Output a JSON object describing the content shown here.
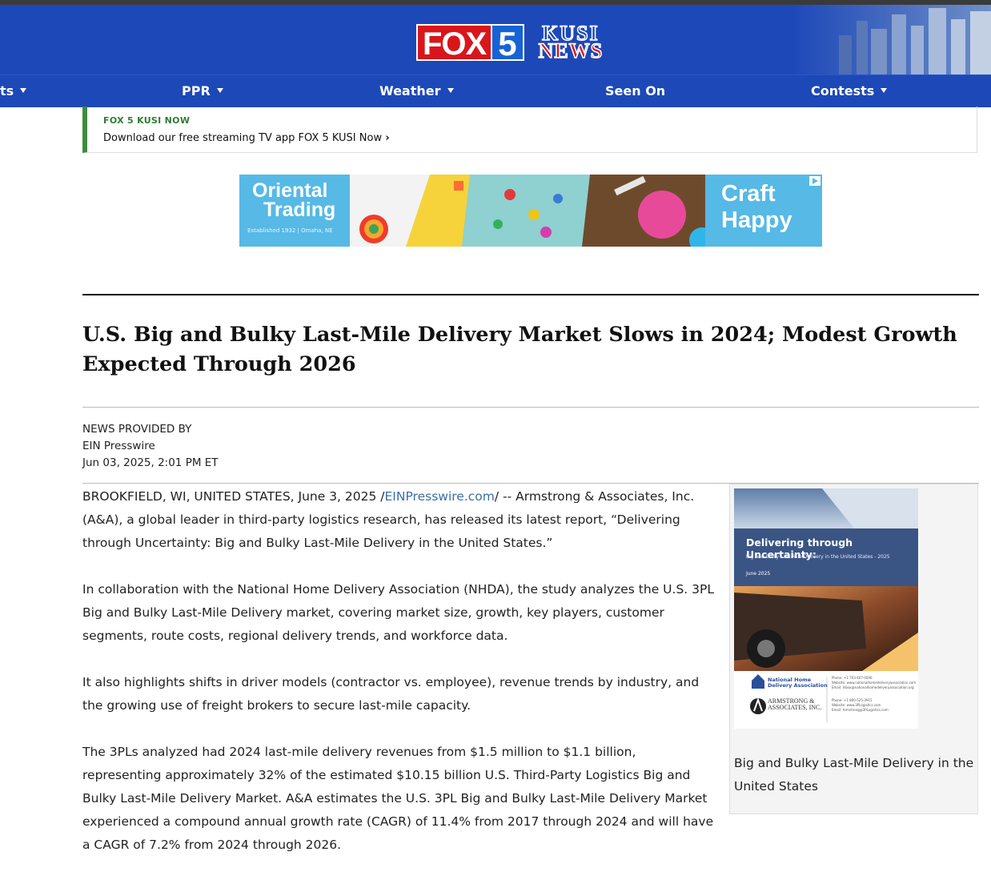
{
  "header": {
    "logo_fox": "FOX",
    "logo_fox_number": "5",
    "logo_kusi_top": "KUSI",
    "logo_kusi_bottom": "NEWS"
  },
  "nav": {
    "items": [
      {
        "label": "ts",
        "has_dropdown": true
      },
      {
        "label": "PPR",
        "has_dropdown": true
      },
      {
        "label": "Weather",
        "has_dropdown": true
      },
      {
        "label": "Seen On",
        "has_dropdown": false
      },
      {
        "label": "Contests",
        "has_dropdown": true
      }
    ]
  },
  "promo": {
    "kicker": "FOX 5 KUSI NOW",
    "text": "Download our free streaming TV app FOX 5 KUSI Now",
    "chevron": "›"
  },
  "ad": {
    "brand_line1": "Oriental",
    "brand_line2": "Trading",
    "established": "Established 1932 | Omaha, NE",
    "cta_line1": "Craft",
    "cta_line2": "Happy"
  },
  "article": {
    "title": "U.S. Big and Bulky Last-Mile Delivery Market Slows in 2024; Modest Growth Expected Through 2026",
    "provided_label": "NEWS PROVIDED BY",
    "provider": "EIN Presswire",
    "datetime": "Jun 03, 2025, 2:01 PM ET",
    "p1_before": "BROOKFIELD, WI, UNITED STATES, June 3, 2025 /",
    "p1_link": "EINPresswire.com",
    "p1_after": "/ -- Armstrong & Associates, Inc. (A&A), a global leader in third-party logistics research, has released its latest report, “Delivering through Uncertainty: Big and Bulky Last-Mile Delivery in the United States.”",
    "p2": "In collaboration with the National Home Delivery Association (NHDA), the study analyzes the U.S. 3PL Big and Bulky Last-Mile Delivery market, covering market size, growth, key players, customer segments, route costs, regional delivery trends, and workforce data.",
    "p3": "It also highlights shifts in driver models (contractor vs. employee), revenue trends by industry, and the growing use of freight brokers to secure last-mile capacity.",
    "p4": "The 3PLs analyzed had 2024 last-mile delivery revenues from $1.5 million to $1.1 billion, representing approximately 32% of the estimated $10.15 billion U.S. Third-Party Logistics Big and Bulky Last-Mile Delivery Market. A&A estimates the U.S. 3PL Big and Bulky Last-Mile Delivery Market experienced a compound annual growth rate (CAGR) of 11.4% from 2017 through 2024 and will have a CAGR of 7.2% from 2024 through 2026."
  },
  "figure": {
    "cover_title": "Delivering through Uncertainty:",
    "cover_subtitle": "Big and Bulky Last-Mile Delivery in the United States - 2025",
    "cover_date": "June 2025",
    "logo1_line1": "National Home",
    "logo1_line2": "Delivery Association",
    "logo2_line1": "ARMSTRONG &",
    "logo2_line2": "ASSOCIATES, INC.",
    "contact1_line1": "Phone: +1 703-407-0596",
    "contact1_line2": "Website: www.nationalhomedeliveryassociation.com",
    "contact1_line3": "Email: Inbox@nationalhomedeliveryassociation.org",
    "contact2_line1": "Phone: +1 800-525-3915",
    "contact2_line2": "Website: www.3PLogistics.com",
    "contact2_line3": "Email: Armstrong@3PLogistics.com",
    "caption": "Big and Bulky Last-Mile Delivery in the United States"
  },
  "colors": {
    "header_blue": "#1d48b8",
    "fox_red": "#d8161b",
    "promo_green": "#3d8b3d",
    "link_blue": "#3b6fa6",
    "ad_blue": "#56b9e6"
  }
}
